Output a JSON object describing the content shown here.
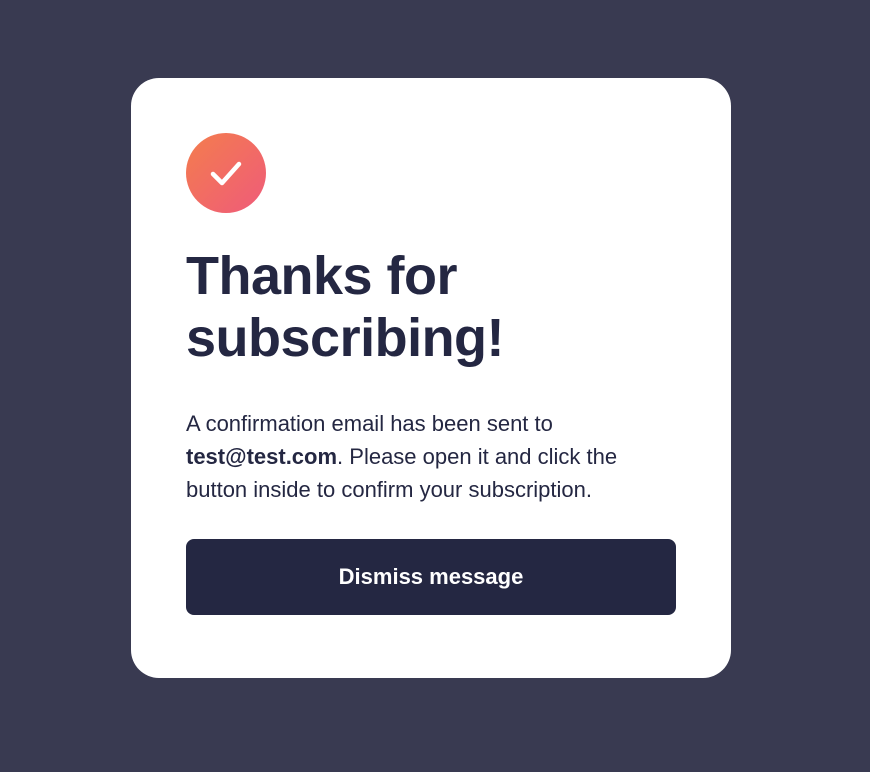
{
  "card": {
    "icon": "checkmark-icon",
    "title": "Thanks for subscribing!",
    "message_prefix": "A confirmation email has been sent to ",
    "email": "test@test.com",
    "message_suffix": ". Please open it and click the button inside to confirm your subscription.",
    "dismiss_label": "Dismiss message"
  },
  "colors": {
    "background": "#393a51",
    "card": "#ffffff",
    "text_dark": "#242742",
    "icon_gradient_start": "#f47d4d",
    "icon_gradient_end": "#ef5b7a"
  }
}
